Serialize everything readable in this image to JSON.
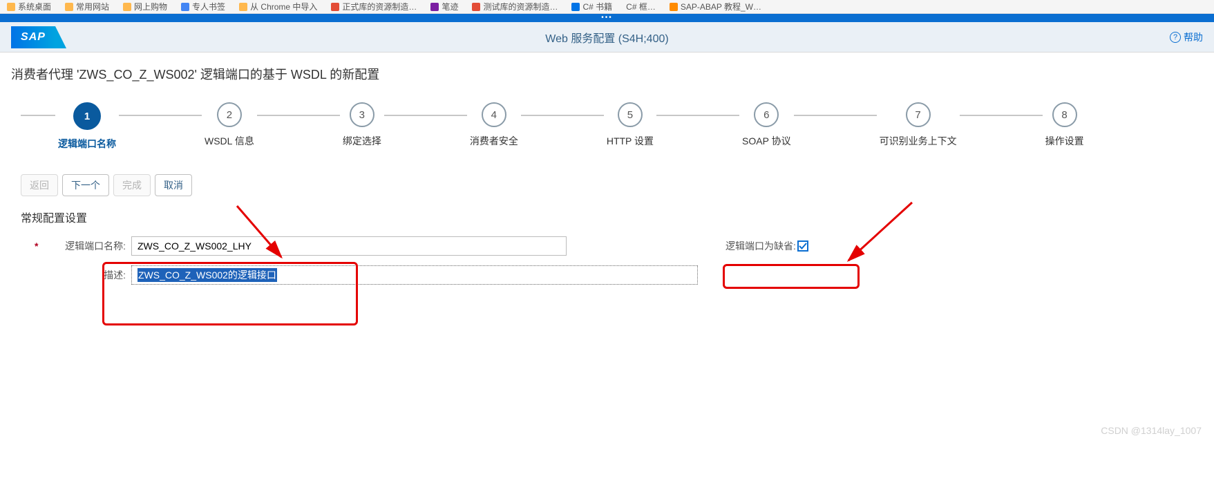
{
  "bookmarks": {
    "items": [
      "系统桌面",
      "常用网站",
      "网上购物",
      "专人书签",
      "从 Chrome 中导入",
      "正式库的资源制造…",
      "笔迹",
      "测试库的资源制造…",
      "C# 书籍",
      "C# 框…",
      "SAP-ABAP 教程_W…"
    ]
  },
  "header": {
    "logo_text": "SAP",
    "title": "Web 服务配置 (S4H;400)",
    "help_text": "帮助"
  },
  "sub_header": "消费者代理 'ZWS_CO_Z_WS002' 逻辑端口的基于 WSDL 的新配置",
  "wizard": {
    "steps": [
      {
        "num": "1",
        "label": "逻辑端口名称"
      },
      {
        "num": "2",
        "label": "WSDL 信息"
      },
      {
        "num": "3",
        "label": "绑定选择"
      },
      {
        "num": "4",
        "label": "消费者安全"
      },
      {
        "num": "5",
        "label": "HTTP 设置"
      },
      {
        "num": "6",
        "label": "SOAP 协议"
      },
      {
        "num": "7",
        "label": "可识别业务上下文"
      },
      {
        "num": "8",
        "label": "操作设置"
      }
    ]
  },
  "actions": {
    "back": "返回",
    "next": "下一个",
    "finish": "完成",
    "cancel": "取消"
  },
  "section": {
    "title": "常规配置设置"
  },
  "form": {
    "name_label": "逻辑端口名称:",
    "name_value": "ZWS_CO_Z_WS002_LHY",
    "desc_label": "描述:",
    "desc_value": "ZWS_CO_Z_WS002的逻辑接口",
    "default_label": "逻辑端口为缺省:",
    "default_checked": true
  },
  "watermark": "CSDN @1314lay_1007"
}
